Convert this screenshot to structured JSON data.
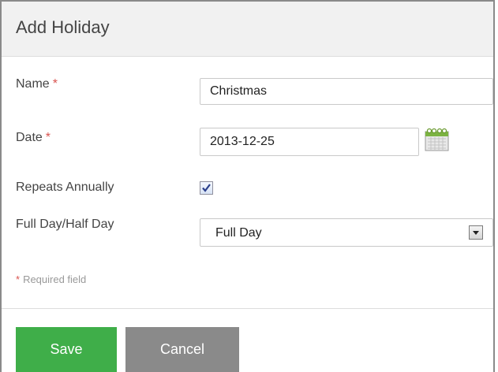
{
  "dialog": {
    "title": "Add Holiday"
  },
  "form": {
    "name": {
      "label": "Name",
      "required_marker": "*",
      "value": "Christmas"
    },
    "date": {
      "label": "Date",
      "required_marker": "*",
      "value": "2013-12-25",
      "icon": "calendar-icon"
    },
    "repeats_annually": {
      "label": "Repeats Annually",
      "checked": true
    },
    "day_type": {
      "label": "Full Day/Half Day",
      "selected": "Full Day"
    },
    "required_note": {
      "marker": "*",
      "text": "Required field"
    }
  },
  "actions": {
    "save_label": "Save",
    "cancel_label": "Cancel"
  },
  "colors": {
    "save": "#3fae49",
    "cancel": "#8a8a8a",
    "required": "#d9534f",
    "header_bg": "#f1f1f1"
  }
}
